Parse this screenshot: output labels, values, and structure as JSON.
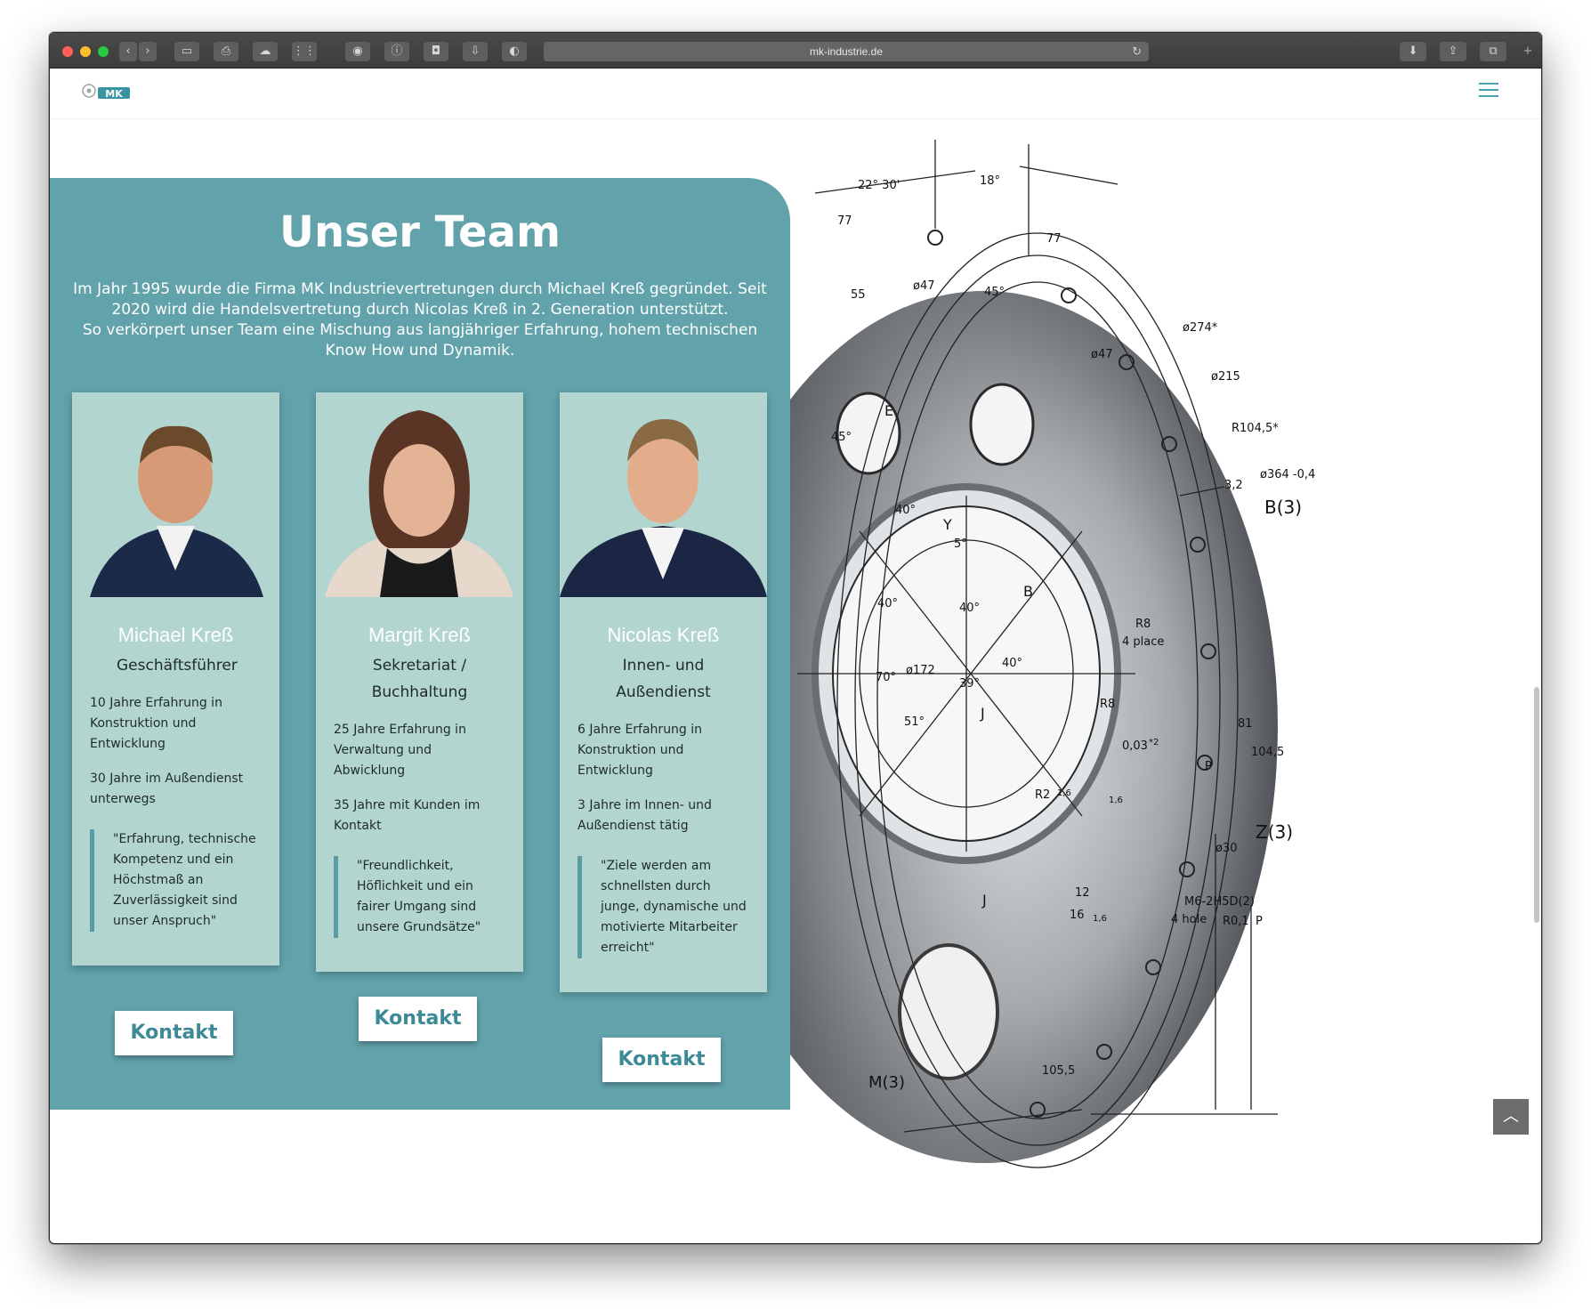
{
  "browser": {
    "url": "mk-industrie.de"
  },
  "site": {
    "logo_text": "MK",
    "colors": {
      "panel": "#62a2ab",
      "card": "#b3d5cf",
      "accent": "#3c8a96",
      "menu": "#4aa3b4"
    }
  },
  "team": {
    "title": "Unser Team",
    "intro_line1": "Im Jahr 1995 wurde die Firma MK Industrievertretungen durch Michael Kreß gegründet. Seit 2020 wird die Handelsvertretung durch Nicolas Kreß in 2. Generation unterstützt.",
    "intro_line2": "So verkörpert unser Team eine Mischung aus langjähriger Erfahrung, hohem technischen Know How und Dynamik.",
    "members": [
      {
        "name": "Michael Kreß",
        "role": "Geschäftsführer",
        "facts": [
          "10 Jahre Erfahrung in Konstruktion und Entwicklung",
          "30 Jahre im Außendienst unterwegs"
        ],
        "quote": "\"Erfahrung, technische Kompetenz und ein Höchstmaß an Zuverlässigkeit sind unser Anspruch\"",
        "button": "Kontakt"
      },
      {
        "name": "Margit Kreß",
        "role": "Sekretariat / Buchhaltung",
        "facts": [
          "25 Jahre Erfahrung in Verwaltung und Abwicklung",
          "35 Jahre mit Kunden im Kontakt"
        ],
        "quote": "\"Freundlichkeit, Höflichkeit und ein fairer Umgang sind unsere Grundsätze\"",
        "button": "Kontakt"
      },
      {
        "name": "Nicolas Kreß",
        "role": "Innen- und Außendienst",
        "facts": [
          "6 Jahre Erfahrung in Konstruktion und Entwicklung",
          "3 Jahre im Innen- und Außendienst tätig"
        ],
        "quote": "\"Ziele werden am schnellsten durch junge, dynamische und motivierte Mitarbeiter erreicht\"",
        "button": "Kontakt"
      }
    ]
  },
  "drawing": {
    "labels": [
      "22° 30'",
      "18°",
      "77",
      "77",
      "55",
      "ø47",
      "45°",
      "ø274*",
      "ø47",
      "ø215",
      "R104,5*",
      "ø364 -0,4",
      "B(3)",
      "45°",
      "E",
      "3,2",
      "40°",
      "Y",
      "5°",
      "40°",
      "40°",
      "B",
      "ø172",
      "70°",
      "39°",
      "40°",
      "R8",
      "4 place",
      "51°",
      "J",
      "R8",
      "0,03",
      "*2",
      "81",
      "104,5",
      "P",
      "R2",
      "1,6",
      "1,6",
      "ø30",
      "Z(3)",
      "J",
      "12",
      "16",
      "1,6",
      "M6-2H5D(2)",
      "4 hole",
      "R0,1",
      "P",
      "M(3)",
      "105,5"
    ]
  }
}
